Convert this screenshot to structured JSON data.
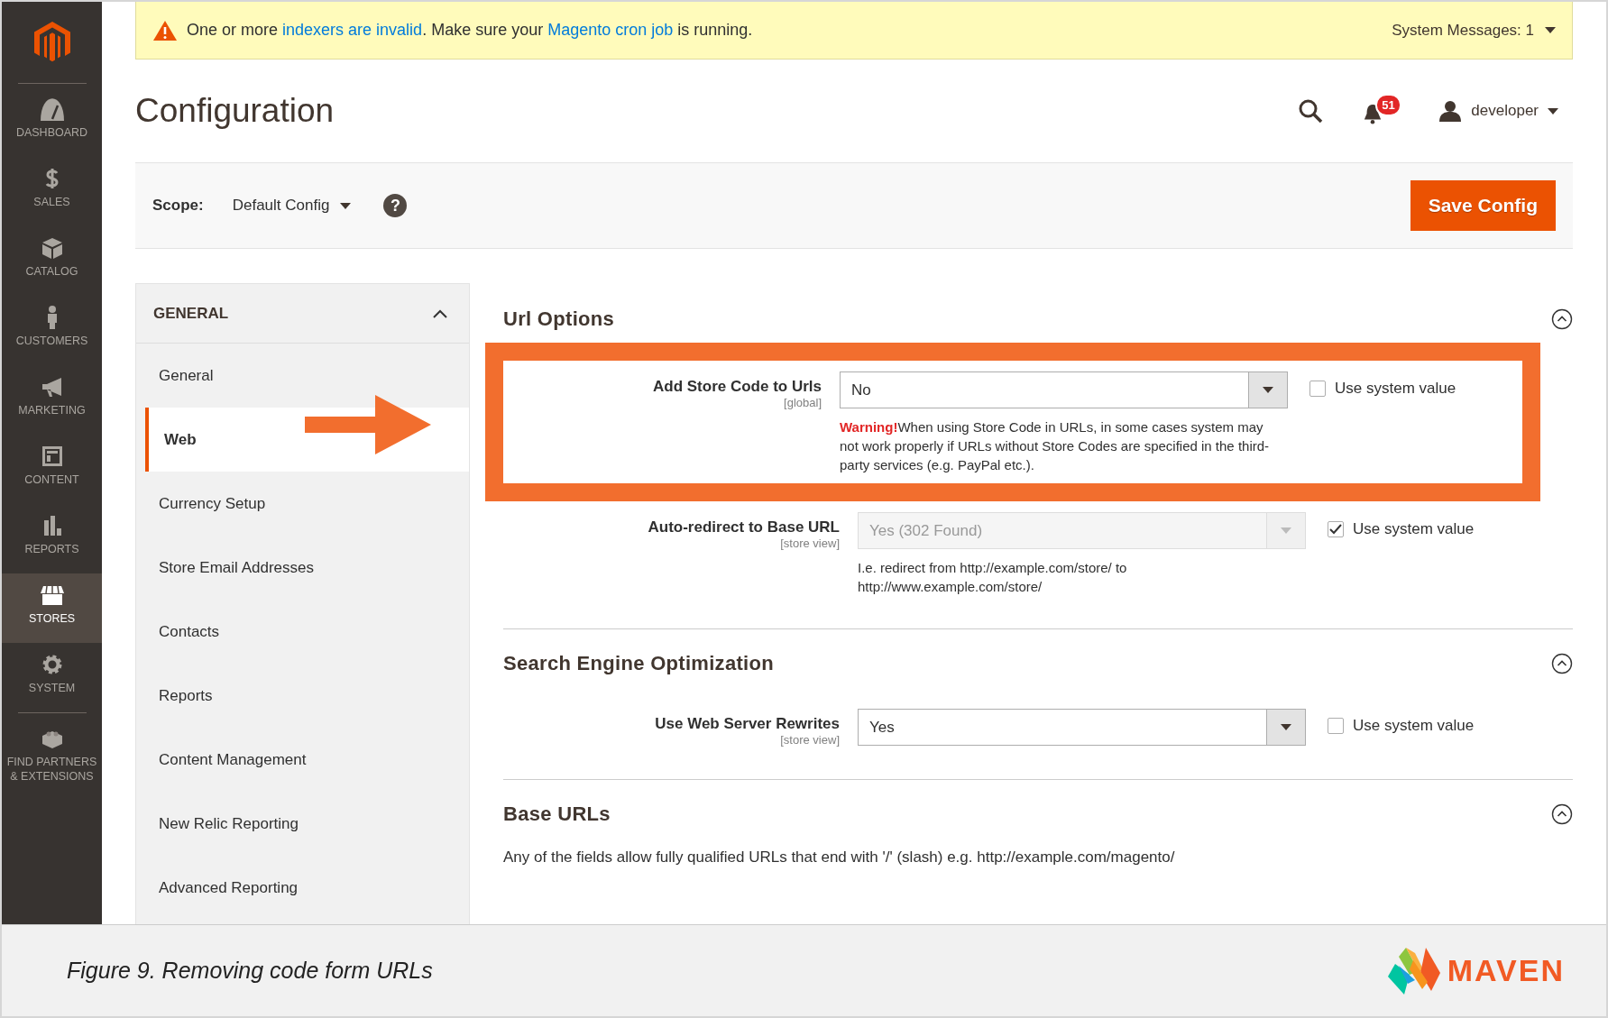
{
  "sidebar": {
    "items": [
      {
        "label": "DASHBOARD",
        "selected": false
      },
      {
        "label": "SALES",
        "selected": false
      },
      {
        "label": "CATALOG",
        "selected": false
      },
      {
        "label": "CUSTOMERS",
        "selected": false
      },
      {
        "label": "MARKETING",
        "selected": false
      },
      {
        "label": "CONTENT",
        "selected": false
      },
      {
        "label": "REPORTS",
        "selected": false
      },
      {
        "label": "STORES",
        "selected": true
      },
      {
        "label": "SYSTEM",
        "selected": false
      },
      {
        "label": "FIND PARTNERS & EXTENSIONS",
        "selected": false
      }
    ]
  },
  "system_message": {
    "parts": [
      {
        "kind": "text",
        "text": "One or more "
      },
      {
        "kind": "link",
        "text": "indexers are invalid"
      },
      {
        "kind": "text",
        "text": ". Make sure your "
      },
      {
        "kind": "link",
        "text": "Magento cron job"
      },
      {
        "kind": "text",
        "text": " is running."
      }
    ],
    "counter": "System Messages: 1"
  },
  "page_title": "Configuration",
  "header": {
    "notifications": "51",
    "user": "developer"
  },
  "scope": {
    "label": "Scope:",
    "value": "Default Config",
    "help": "?"
  },
  "save_button": "Save Config",
  "nav": {
    "title": "GENERAL",
    "expanded": true,
    "items": [
      {
        "label": "General",
        "selected": false
      },
      {
        "label": "Web",
        "selected": true
      },
      {
        "label": "Currency Setup",
        "selected": false
      },
      {
        "label": "Store Email Addresses",
        "selected": false
      },
      {
        "label": "Contacts",
        "selected": false
      },
      {
        "label": "Reports",
        "selected": false
      },
      {
        "label": "Content Management",
        "selected": false
      },
      {
        "label": "New Relic Reporting",
        "selected": false
      },
      {
        "label": "Advanced Reporting",
        "selected": false
      }
    ]
  },
  "sections": [
    {
      "title": "Url Options",
      "expanded": true,
      "fields": [
        {
          "label": "Add Store Code to Urls",
          "scope": "[global]",
          "value": "No",
          "disabled": false,
          "use_system_value": false,
          "system_value_label": "Use system value",
          "highlighted": true,
          "warning": "Warning!",
          "comment": "When using Store Code in URLs, in some cases system may not work properly if URLs without Store Codes are specified in the third-party services (e.g. PayPal etc.)."
        },
        {
          "label": "Auto-redirect to Base URL",
          "scope": "[store view]",
          "value": "Yes (302 Found)",
          "disabled": true,
          "use_system_value": true,
          "system_value_label": "Use system value",
          "comment": "I.e. redirect from http://example.com/store/ to http://www.example.com/store/"
        }
      ]
    },
    {
      "title": "Search Engine Optimization",
      "expanded": true,
      "fields": [
        {
          "label": "Use Web Server Rewrites",
          "scope": "[store view]",
          "value": "Yes",
          "disabled": false,
          "use_system_value": false,
          "system_value_label": "Use system value"
        }
      ]
    },
    {
      "title": "Base URLs",
      "expanded": true,
      "description": "Any of the fields allow fully qualified URLs that end with '/' (slash) e.g. http://example.com/magento/"
    }
  ],
  "caption": "Figure 9. Removing code form URLs",
  "brand": "MAVEN"
}
